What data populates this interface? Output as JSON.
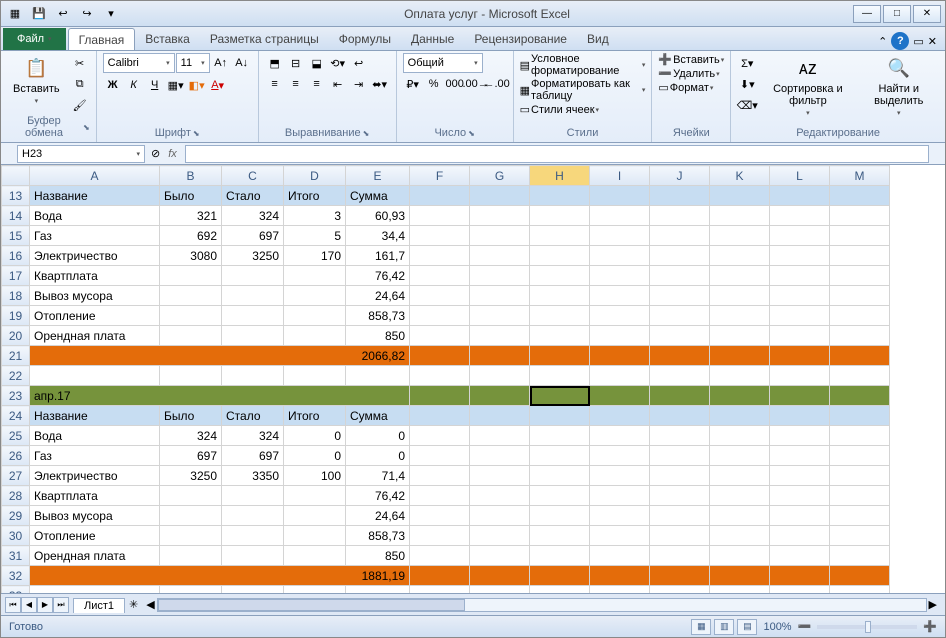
{
  "title": "Оплата услуг - Microsoft Excel",
  "qat": {
    "save": "💾",
    "undo": "↩",
    "redo": "↪"
  },
  "tabs": {
    "file": "Файл",
    "items": [
      "Главная",
      "Вставка",
      "Разметка страницы",
      "Формулы",
      "Данные",
      "Рецензирование",
      "Вид"
    ],
    "active": 0
  },
  "ribbon": {
    "clipboard": {
      "label": "Буфер обмена",
      "paste": "Вставить"
    },
    "font": {
      "label": "Шрифт",
      "name": "Calibri",
      "size": "11"
    },
    "align": {
      "label": "Выравнивание"
    },
    "number": {
      "label": "Число",
      "format": "Общий"
    },
    "styles": {
      "label": "Стили",
      "cond": "Условное форматирование",
      "table": "Форматировать как таблицу",
      "cell": "Стили ячеек"
    },
    "cells": {
      "label": "Ячейки",
      "insert": "Вставить",
      "delete": "Удалить",
      "format": "Формат"
    },
    "edit": {
      "label": "Редактирование",
      "sort": "Сортировка и фильтр",
      "find": "Найти и выделить"
    }
  },
  "namebox": "H23",
  "columns": [
    "A",
    "B",
    "C",
    "D",
    "E",
    "F",
    "G",
    "H",
    "I",
    "J",
    "K",
    "L",
    "M"
  ],
  "rows": [
    {
      "n": 13,
      "cls": "hdr-row",
      "c": [
        "Название",
        "Было",
        "Стало",
        "Итого",
        "Сумма",
        "",
        "",
        "",
        "",
        "",
        "",
        "",
        ""
      ]
    },
    {
      "n": 14,
      "c": [
        "Вода",
        "321",
        "324",
        "3",
        "60,93",
        "",
        "",
        "",
        "",
        "",
        "",
        "",
        ""
      ],
      "ra": [
        1,
        2,
        3,
        4
      ]
    },
    {
      "n": 15,
      "c": [
        "Газ",
        "692",
        "697",
        "5",
        "34,4",
        "",
        "",
        "",
        "",
        "",
        "",
        "",
        ""
      ],
      "ra": [
        1,
        2,
        3,
        4
      ]
    },
    {
      "n": 16,
      "c": [
        "Электричество",
        "3080",
        "3250",
        "170",
        "161,7",
        "",
        "",
        "",
        "",
        "",
        "",
        "",
        ""
      ],
      "ra": [
        1,
        2,
        3,
        4
      ]
    },
    {
      "n": 17,
      "c": [
        "Квартплата",
        "",
        "",
        "",
        "76,42",
        "",
        "",
        "",
        "",
        "",
        "",
        "",
        ""
      ],
      "ra": [
        4
      ]
    },
    {
      "n": 18,
      "c": [
        "Вывоз мусора",
        "",
        "",
        "",
        "24,64",
        "",
        "",
        "",
        "",
        "",
        "",
        "",
        ""
      ],
      "ra": [
        4
      ]
    },
    {
      "n": 19,
      "c": [
        "Отопление",
        "",
        "",
        "",
        "858,73",
        "",
        "",
        "",
        "",
        "",
        "",
        "",
        ""
      ],
      "ra": [
        4
      ]
    },
    {
      "n": 20,
      "c": [
        "Орендная плата",
        "",
        "",
        "",
        "850",
        "",
        "",
        "",
        "",
        "",
        "",
        "",
        ""
      ],
      "ra": [
        4
      ]
    },
    {
      "n": 21,
      "cls": "orange-row",
      "c": [
        "",
        "",
        "",
        "",
        "2066,82",
        "",
        "",
        "",
        "",
        "",
        "",
        "",
        ""
      ],
      "ra": [
        4
      ],
      "span": 5
    },
    {
      "n": 22,
      "c": [
        "",
        "",
        "",
        "",
        "",
        "",
        "",
        "",
        "",
        "",
        "",
        "",
        ""
      ]
    },
    {
      "n": 23,
      "cls": "green-row",
      "c": [
        "апр.17",
        "",
        "",
        "",
        "",
        "",
        "",
        "",
        "",
        "",
        "",
        "",
        ""
      ],
      "span": 5,
      "sel": 7
    },
    {
      "n": 24,
      "cls": "hdr-row",
      "c": [
        "Название",
        "Было",
        "Стало",
        "Итого",
        "Сумма",
        "",
        "",
        "",
        "",
        "",
        "",
        "",
        ""
      ]
    },
    {
      "n": 25,
      "c": [
        "Вода",
        "324",
        "324",
        "0",
        "0",
        "",
        "",
        "",
        "",
        "",
        "",
        "",
        ""
      ],
      "ra": [
        1,
        2,
        3,
        4
      ]
    },
    {
      "n": 26,
      "c": [
        "Газ",
        "697",
        "697",
        "0",
        "0",
        "",
        "",
        "",
        "",
        "",
        "",
        "",
        ""
      ],
      "ra": [
        1,
        2,
        3,
        4
      ]
    },
    {
      "n": 27,
      "c": [
        "Электричество",
        "3250",
        "3350",
        "100",
        "71,4",
        "",
        "",
        "",
        "",
        "",
        "",
        "",
        ""
      ],
      "ra": [
        1,
        2,
        3,
        4
      ]
    },
    {
      "n": 28,
      "c": [
        "Квартплата",
        "",
        "",
        "",
        "76,42",
        "",
        "",
        "",
        "",
        "",
        "",
        "",
        ""
      ],
      "ra": [
        4
      ]
    },
    {
      "n": 29,
      "c": [
        "Вывоз мусора",
        "",
        "",
        "",
        "24,64",
        "",
        "",
        "",
        "",
        "",
        "",
        "",
        ""
      ],
      "ra": [
        4
      ]
    },
    {
      "n": 30,
      "c": [
        "Отопление",
        "",
        "",
        "",
        "858,73",
        "",
        "",
        "",
        "",
        "",
        "",
        "",
        ""
      ],
      "ra": [
        4
      ]
    },
    {
      "n": 31,
      "c": [
        "Орендная плата",
        "",
        "",
        "",
        "850",
        "",
        "",
        "",
        "",
        "",
        "",
        "",
        ""
      ],
      "ra": [
        4
      ]
    },
    {
      "n": 32,
      "cls": "orange-row",
      "c": [
        "",
        "",
        "",
        "",
        "1881,19",
        "",
        "",
        "",
        "",
        "",
        "",
        "",
        ""
      ],
      "ra": [
        4
      ],
      "span": 5
    },
    {
      "n": 33,
      "c": [
        "",
        "",
        "",
        "",
        "",
        "",
        "",
        "",
        "",
        "",
        "",
        "",
        ""
      ]
    }
  ],
  "sheet_tab": "Лист1",
  "status": {
    "ready": "Готово",
    "zoom": "100%"
  }
}
